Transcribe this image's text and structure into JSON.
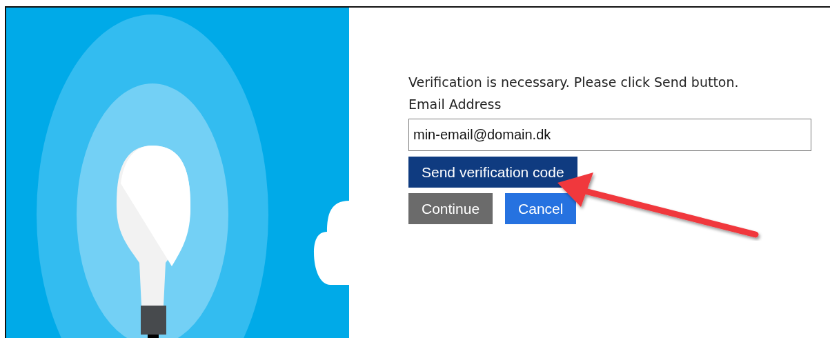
{
  "message": "Verification is necessary. Please click Send button.",
  "email": {
    "label": "Email Address",
    "value": "min-email@domain.dk"
  },
  "send_button": {
    "label": "Send verification code",
    "kind": "primary"
  },
  "actions": [
    {
      "label": "Continue",
      "kind": "secondary"
    },
    {
      "label": "Cancel",
      "kind": "cancel"
    }
  ]
}
